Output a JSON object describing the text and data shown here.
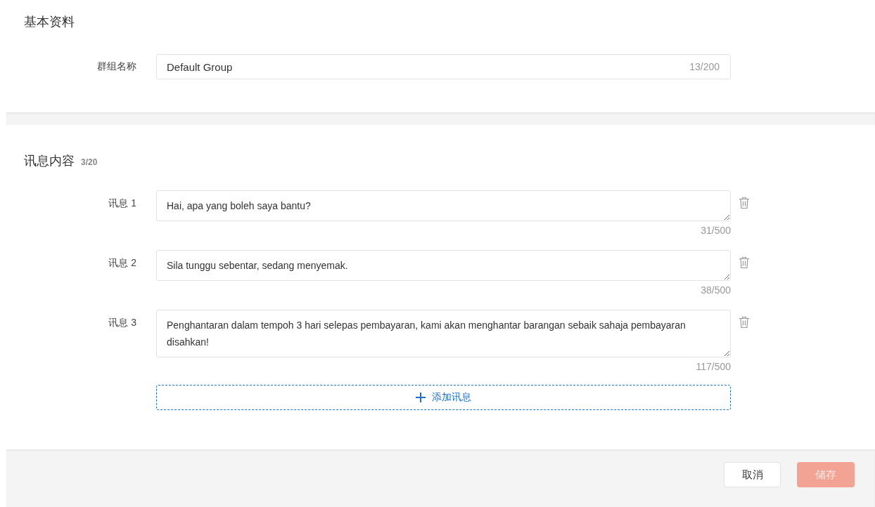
{
  "basic_info": {
    "title": "基本资料",
    "group_name": {
      "label": "群组名称",
      "value": "Default Group",
      "count": "13/200"
    }
  },
  "messages": {
    "title": "讯息内容",
    "count": "3/20",
    "items": [
      {
        "label": "讯息 1",
        "value": "Hai, apa yang boleh saya bantu?",
        "count": "31/500"
      },
      {
        "label": "讯息 2",
        "value": "Sila tunggu sebentar, sedang menyemak.",
        "count": "38/500"
      },
      {
        "label": "讯息 3",
        "value": "Penghantaran dalam tempoh 3 hari selepas pembayaran, kami akan menghantar barangan sebaik sahaja pembayaran disahkan!",
        "count": "117/500"
      }
    ],
    "add_button": "添加讯息"
  },
  "footer": {
    "cancel": "取消",
    "save": {
      "label": "储存",
      "disabled": true
    }
  }
}
